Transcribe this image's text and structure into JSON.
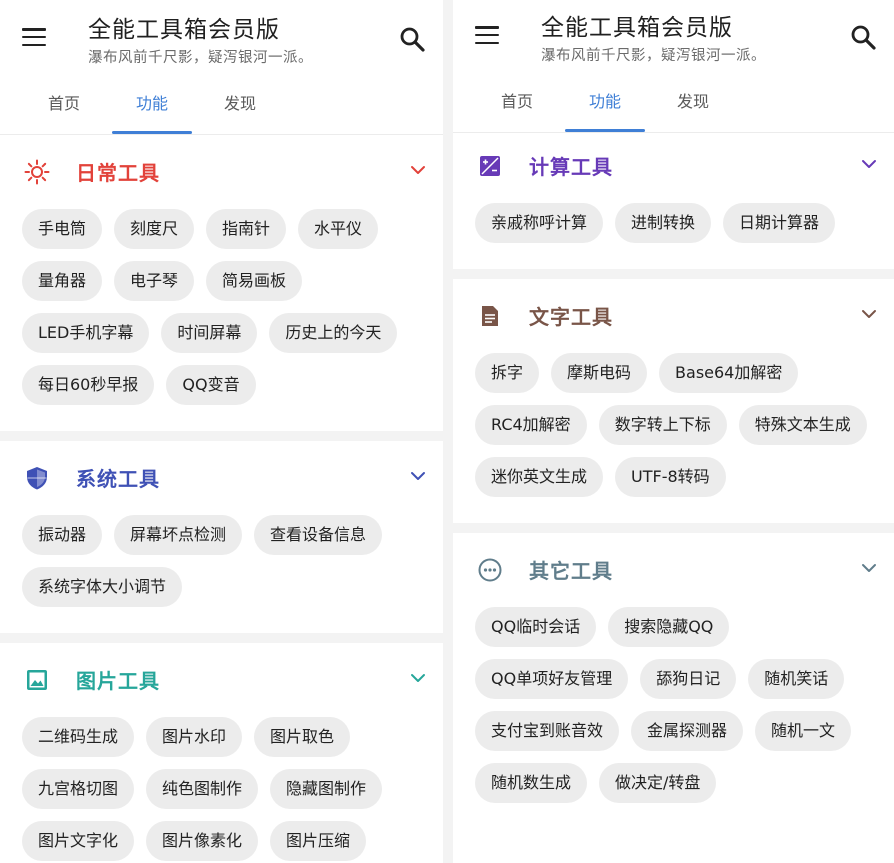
{
  "app": {
    "title": "全能工具箱会员版",
    "subtitle": "瀑布风前千尺影，疑泻银河一派。"
  },
  "tabs": [
    {
      "label": "首页",
      "active": false
    },
    {
      "label": "功能",
      "active": true
    },
    {
      "label": "发现",
      "active": false
    }
  ],
  "colors": {
    "accent": "#3f7fd6",
    "chip_bg": "#ececec",
    "daily": "#e2423a",
    "system": "#3f51b5",
    "image": "#26a69a",
    "calc": "#673ab7",
    "text": "#795548",
    "other": "#607d8b"
  },
  "left": {
    "sections": [
      {
        "title": "日常工具",
        "icon": "sun-icon",
        "color": "#e2423a",
        "items": [
          "手电筒",
          "刻度尺",
          "指南针",
          "水平仪",
          "量角器",
          "电子琴",
          "简易画板",
          "LED手机字幕",
          "时间屏幕",
          "历史上的今天",
          "每日60秒早报",
          "QQ变音"
        ]
      },
      {
        "title": "系统工具",
        "icon": "shield-icon",
        "color": "#3f51b5",
        "items": [
          "振动器",
          "屏幕坏点检测",
          "查看设备信息",
          "系统字体大小调节"
        ]
      },
      {
        "title": "图片工具",
        "icon": "image-icon",
        "color": "#26a69a",
        "items": [
          "二维码生成",
          "图片水印",
          "图片取色",
          "九宫格切图",
          "纯色图制作",
          "隐藏图制作",
          "图片文字化",
          "图片像素化",
          "图片压缩"
        ]
      }
    ]
  },
  "right": {
    "sections": [
      {
        "title": "计算工具",
        "icon": "calculator-icon",
        "color": "#673ab7",
        "items": [
          "亲戚称呼计算",
          "进制转换",
          "日期计算器"
        ]
      },
      {
        "title": "文字工具",
        "icon": "document-icon",
        "color": "#795548",
        "items": [
          "拆字",
          "摩斯电码",
          "Base64加解密",
          "RC4加解密",
          "数字转上下标",
          "特殊文本生成",
          "迷你英文生成",
          "UTF-8转码"
        ]
      },
      {
        "title": "其它工具",
        "icon": "more-icon",
        "color": "#607d8b",
        "items": [
          "QQ临时会话",
          "搜索隐藏QQ",
          "QQ单项好友管理",
          "舔狗日记",
          "随机笑话",
          "支付宝到账音效",
          "金属探测器",
          "随机一文",
          "随机数生成",
          "做决定/转盘"
        ]
      }
    ]
  }
}
